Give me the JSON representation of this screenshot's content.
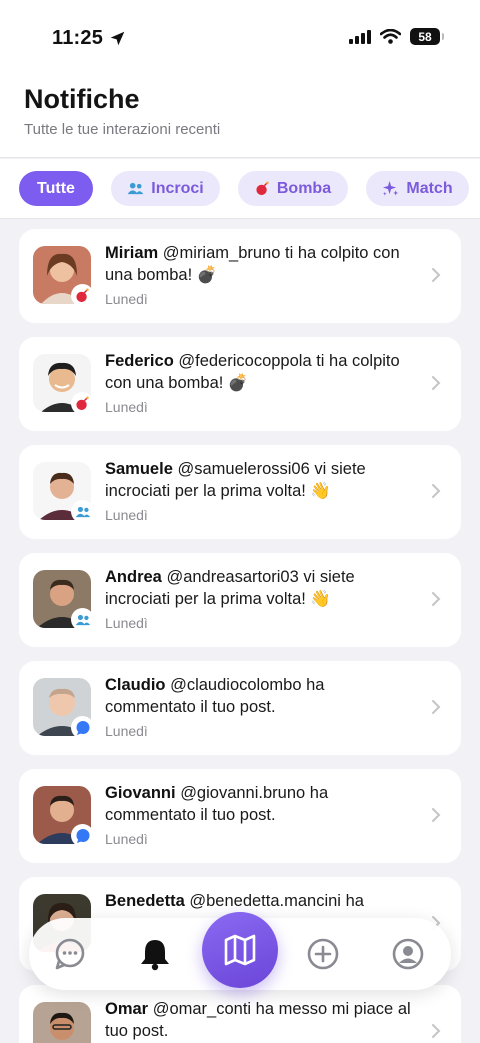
{
  "status_bar": {
    "time": "11:25",
    "battery": "58"
  },
  "header": {
    "title": "Notifiche",
    "subtitle": "Tutte le tue interazioni recenti"
  },
  "filters": [
    {
      "label": "Tutte",
      "icon": "none",
      "active": true
    },
    {
      "label": "Incroci",
      "icon": "people-icon",
      "active": false
    },
    {
      "label": "Bomba",
      "icon": "bomb-icon",
      "active": false
    },
    {
      "label": "Match",
      "icon": "sparkles-icon",
      "active": false
    }
  ],
  "notifications": [
    {
      "name": "Miriam",
      "handle": "@miriam_bruno",
      "action": "ti ha colpito con una bomba! 💣",
      "time": "Lunedì",
      "type": "bomb"
    },
    {
      "name": "Federico",
      "handle": "@federicocoppola",
      "action": "ti ha colpito con una bomba! 💣",
      "time": "Lunedì",
      "type": "bomb"
    },
    {
      "name": "Samuele",
      "handle": "@samuelerossi06",
      "action": "vi siete incrociati per la prima volta! 👋",
      "time": "Lunedì",
      "type": "cross"
    },
    {
      "name": "Andrea",
      "handle": "@andreasartori03",
      "action": "vi siete incrociati per la prima volta! 👋",
      "time": "Lunedì",
      "type": "cross"
    },
    {
      "name": "Claudio",
      "handle": "@claudiocolombo",
      "action": "ha commentato il tuo post.",
      "time": "Lunedì",
      "type": "comment"
    },
    {
      "name": "Giovanni",
      "handle": "@giovanni.bruno",
      "action": "ha commentato il tuo post.",
      "time": "Lunedì",
      "type": "comment"
    },
    {
      "name": "Benedetta",
      "handle": "@benedetta.mancini",
      "action": "ha",
      "time": "",
      "type": "comment"
    },
    {
      "name": "Omar",
      "handle": "@omar_conti",
      "action": "ha messo mi piace al tuo post.",
      "time": "",
      "type": "like"
    }
  ],
  "tabbar": {
    "items": [
      "chat-icon",
      "bell-icon",
      "map-icon",
      "plus-circle-icon",
      "profile-icon"
    ],
    "active": "bell-icon"
  },
  "colors": {
    "accent": "#7d5cf0",
    "chip_bg": "#ece8fb",
    "bomb": "#e0283c",
    "cross": "#3a9bd5",
    "comment": "#3478f6"
  }
}
